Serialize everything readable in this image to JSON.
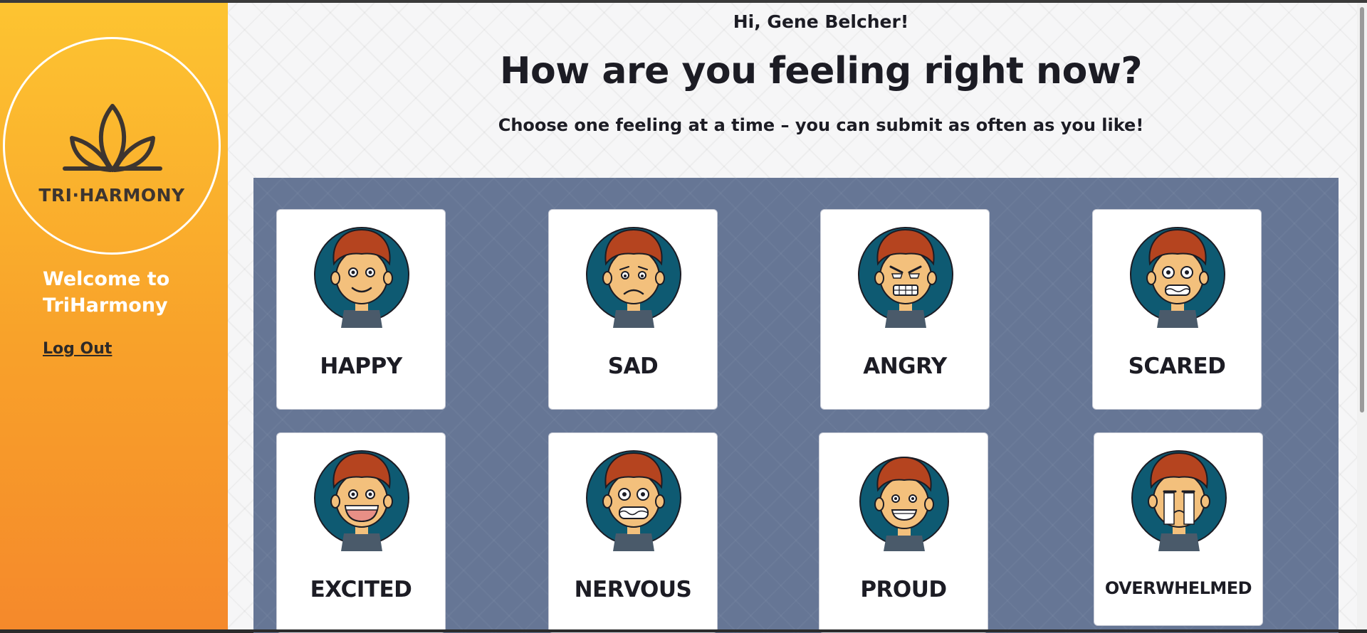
{
  "sidebar": {
    "logo_text": "TRI·HARMONY",
    "welcome": "Welcome to TriHarmony",
    "logout_label": "Log Out"
  },
  "header": {
    "greeting": "Hi, Gene Belcher!",
    "title": "How are you feeling right now?",
    "subtitle": "Choose one feeling at a time – you can submit as often as you like!"
  },
  "feelings": [
    {
      "label": "HAPPY",
      "icon": "happy-face-icon"
    },
    {
      "label": "SAD",
      "icon": "sad-face-icon"
    },
    {
      "label": "ANGRY",
      "icon": "angry-face-icon"
    },
    {
      "label": "SCARED",
      "icon": "scared-face-icon"
    },
    {
      "label": "EXCITED",
      "icon": "excited-face-icon"
    },
    {
      "label": "NERVOUS",
      "icon": "nervous-face-icon"
    },
    {
      "label": "PROUD",
      "icon": "proud-face-icon"
    },
    {
      "label": "OVERWHELMED",
      "icon": "overwhelmed-face-icon"
    }
  ],
  "colors": {
    "sidebar_top": "#fdc431",
    "sidebar_bottom": "#f5892b",
    "grid_background": "#667695",
    "avatar_circle": "#0e5a72",
    "hair": "#b5441f",
    "skin": "#f3c07c"
  }
}
